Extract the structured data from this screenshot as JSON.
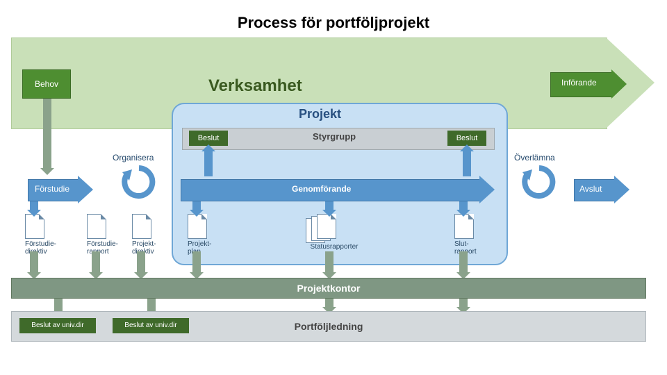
{
  "title": "Process för portföljprojekt",
  "verksamhet": "Verksamhet",
  "behov": "Behov",
  "inforande": "Införande",
  "projekt": "Projekt",
  "styrgrupp": "Styrgrupp",
  "beslut": "Beslut",
  "organisera": "Organisera",
  "overlamna": "Överlämna",
  "phases": {
    "forstudie": "Förstudie",
    "genomforande": "Genomförande",
    "avslut": "Avslut"
  },
  "documents": {
    "forstudie_direktiv": "Förstudie-\ndirektiv",
    "forstudie_rapport": "Förstudie-\nrapport",
    "projekt_direktiv": "Projekt-\ndirektiv",
    "projekt_plan": "Projekt-\nplan",
    "statusrapporter": "Statusrapporter",
    "slut_rapport": "Slut-\nrapport"
  },
  "projektkontor": "Projektkontor",
  "portfoljledning": "Portföljledning",
  "decision": "Beslut av univ.dir"
}
